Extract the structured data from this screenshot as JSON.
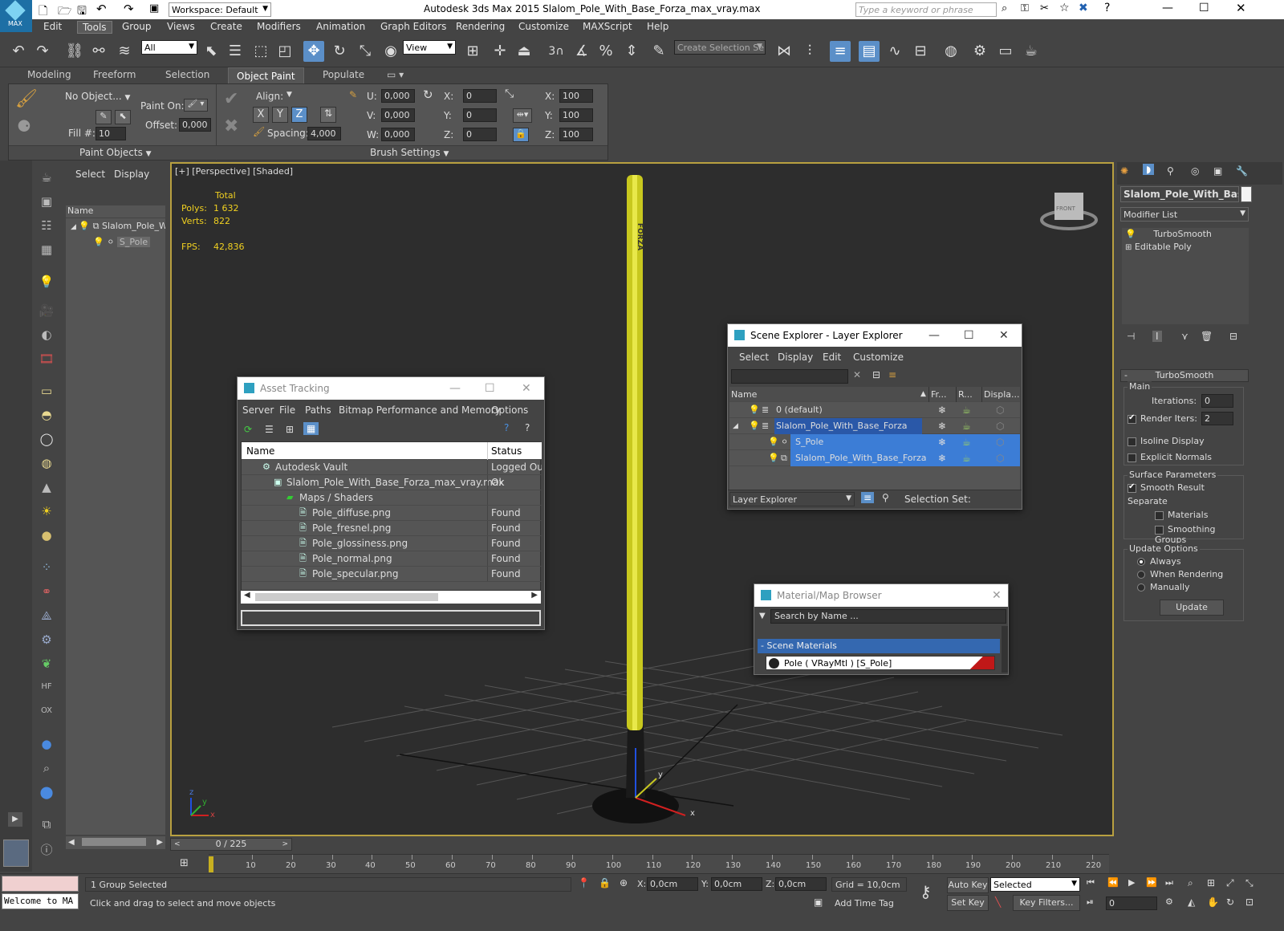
{
  "titlebar": {
    "title": "Autodesk 3ds Max  2015      Slalom_Pole_With_Base_Forza_max_vray.max",
    "workspace": "Workspace: Default",
    "search_placeholder": "Type a keyword or phrase",
    "app_badge": "MAX"
  },
  "menu": [
    "Edit",
    "Tools",
    "Group",
    "Views",
    "Create",
    "Modifiers",
    "Animation",
    "Graph Editors",
    "Rendering",
    "Customize",
    "MAXScript",
    "Help"
  ],
  "toolbar": {
    "filter": "All",
    "view": "View",
    "selection_set": "Create Selection Se",
    "snap_3": "3"
  },
  "ribbon": {
    "tabs": [
      "Modeling",
      "Freeform",
      "Selection",
      "Object Paint",
      "Populate"
    ],
    "active_tab": "Object Paint",
    "no_object": "No Object...",
    "paint_on": "Paint On:",
    "offset_label": "Offset:",
    "offset": "0,000",
    "fill_label": "Fill #:",
    "fill": "10",
    "align_label": "Align:",
    "axes": [
      "X",
      "Y",
      "Z"
    ],
    "spacing_label": "Spacing:",
    "spacing": "4,000",
    "u_label": "U:",
    "u": "0,000",
    "v_label": "V:",
    "v": "0,000",
    "w_label": "W:",
    "w": "0,000",
    "rx_label": "X:",
    "rx": "0",
    "ry_label": "Y:",
    "ry": "0",
    "rz_label": "Z:",
    "rz": "0",
    "sx_label": "X:",
    "sx": "100",
    "sy_label": "Y:",
    "sy": "100",
    "sz_label": "Z:",
    "sz": "100",
    "group1": "Paint Objects",
    "group2": "Brush Settings"
  },
  "explorer": {
    "tabs": [
      "Select",
      "Display"
    ],
    "col_name": "Name",
    "items": [
      "Slalom_Pole_W",
      "S_Pole"
    ]
  },
  "viewport": {
    "label": "[+] [Perspective] [Shaded]",
    "stats_header": "Total",
    "polys_label": "Polys:",
    "polys": "1 632",
    "verts_label": "Verts:",
    "verts": "822",
    "fps_label": "FPS:",
    "fps": "42,836",
    "pole_text": "FORZA",
    "viewcube": "FRONT",
    "axis_x": "x",
    "axis_y": "y",
    "axis_z": "z"
  },
  "asset_tracking": {
    "title": "Asset Tracking",
    "menu": [
      "Server",
      "File",
      "Paths",
      "Bitmap Performance and Memory",
      "Options"
    ],
    "col_name": "Name",
    "col_status": "Status",
    "rows": [
      {
        "name": "Autodesk Vault",
        "status": "Logged Out ..."
      },
      {
        "name": "Slalom_Pole_With_Base_Forza_max_vray.max",
        "status": "Ok"
      },
      {
        "name": "Maps / Shaders",
        "status": ""
      },
      {
        "name": "Pole_diffuse.png",
        "status": "Found"
      },
      {
        "name": "Pole_fresnel.png",
        "status": "Found"
      },
      {
        "name": "Pole_glossiness.png",
        "status": "Found"
      },
      {
        "name": "Pole_normal.png",
        "status": "Found"
      },
      {
        "name": "Pole_specular.png",
        "status": "Found"
      }
    ]
  },
  "scene_explorer": {
    "title": "Scene Explorer - Layer Explorer",
    "menu": [
      "Select",
      "Display",
      "Edit",
      "Customize"
    ],
    "cols": [
      "Name",
      "Fr...",
      "R...",
      "Displa..."
    ],
    "rows": [
      "0 (default)",
      "Slalom_Pole_With_Base_Forza",
      "S_Pole",
      "Slalom_Pole_With_Base_Forza"
    ],
    "footer_dropdown": "Layer Explorer",
    "selection_set": "Selection Set:"
  },
  "material_browser": {
    "title": "Material/Map Browser",
    "search_placeholder": "Search by Name ...",
    "group": "- Scene Materials",
    "item": "Pole  ( VRayMtl )  [S_Pole]"
  },
  "command_panel": {
    "object_name": "Slalom_Pole_With_Base_",
    "modifier_list": "Modifier List",
    "stack": [
      "TurboSmooth",
      "Editable Poly"
    ],
    "rollout": "TurboSmooth",
    "main": "Main",
    "iterations_label": "Iterations:",
    "iterations": "0",
    "render_iters_label": "Render Iters:",
    "render_iters": "2",
    "isoline": "Isoline Display",
    "explicit_normals": "Explicit Normals",
    "surface_params": "Surface Parameters",
    "smooth_result": "Smooth Result",
    "separate": "Separate",
    "materials": "Materials",
    "smoothing_groups": "Smoothing Groups",
    "update_options": "Update Options",
    "always": "Always",
    "when_rendering": "When Rendering",
    "manually": "Manually",
    "update": "Update"
  },
  "timeline": {
    "frame": "0 / 225",
    "ticks": [
      "10",
      "20",
      "30",
      "40",
      "50",
      "60",
      "70",
      "80",
      "90",
      "100",
      "110",
      "120",
      "130",
      "140",
      "150",
      "160",
      "170",
      "180",
      "190",
      "200",
      "210",
      "220"
    ]
  },
  "statusbar": {
    "welcome": "Welcome to MA",
    "selected": "1 Group Selected",
    "prompt": "Click and drag to select and move objects",
    "x_label": "X:",
    "x": "0,0cm",
    "y_label": "Y:",
    "y": "0,0cm",
    "z_label": "Z:",
    "z": "0,0cm",
    "grid": "Grid = 10,0cm",
    "add_time_tag": "Add Time Tag",
    "auto_key": "Auto Key",
    "set_key": "Set Key",
    "selected_dd": "Selected",
    "key_filters": "Key Filters...",
    "frame_field": "0"
  }
}
